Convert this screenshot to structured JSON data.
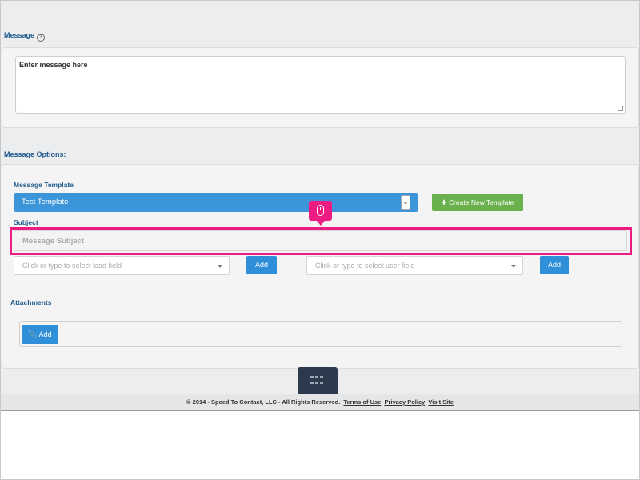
{
  "message": {
    "label": "Message",
    "help_icon": "question-circle-icon",
    "textarea_value": "Enter message here"
  },
  "options": {
    "label": "Message Options:",
    "template": {
      "label": "Message Template",
      "selected": "Test Template",
      "create_button": "Create New Template"
    },
    "subject": {
      "label": "Subject",
      "placeholder": "Message Subject"
    },
    "lead_field": {
      "placeholder": "Click or type to select lead field",
      "add_label": "Add"
    },
    "user_field": {
      "placeholder": "Click or type to select user field",
      "add_label": "Add"
    },
    "attachments": {
      "label": "Attachments",
      "add_label": "Add"
    }
  },
  "footer": {
    "copyright": "© 2014 - Speed To Contact, LLC - All Rights Reserved.",
    "terms": "Terms of Use",
    "privacy": "Privacy Policy",
    "visit": "Visit Site"
  },
  "colors": {
    "accent": "#3b95d8",
    "success": "#6ab04c",
    "highlight": "#ec1c82",
    "nav_dark": "#2b3a4d"
  }
}
